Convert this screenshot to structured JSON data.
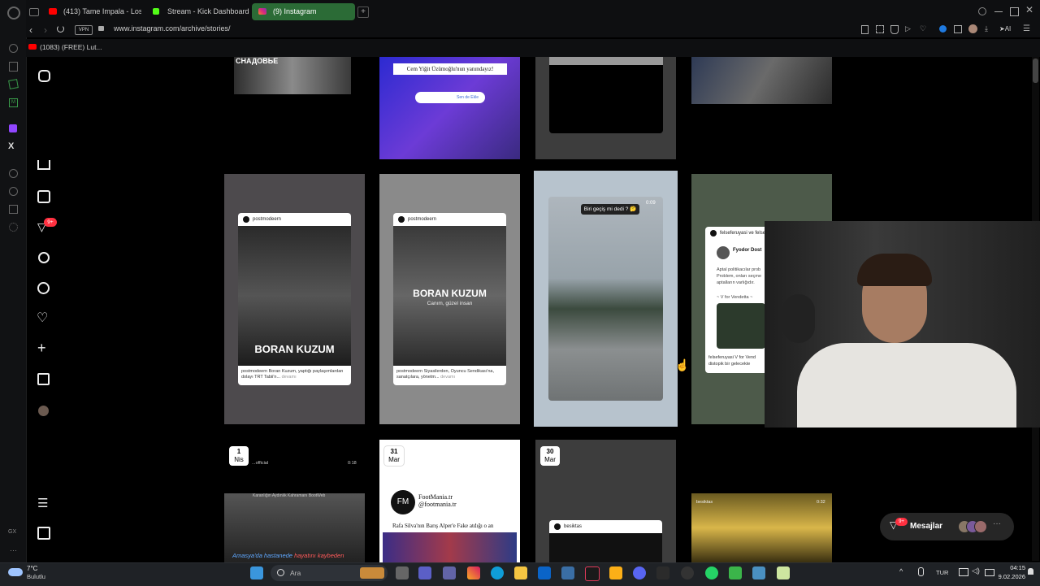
{
  "browser": {
    "tabs": [
      {
        "label": "(413) Tame Impala - Loser",
        "icon": "youtube-icon"
      },
      {
        "label": "Stream - Kick Dashboard",
        "icon": "kick-icon"
      },
      {
        "label": "(9) Instagram",
        "icon": "instagram-icon",
        "active": true
      }
    ],
    "url": "www.instagram.com/archive/stories/",
    "vpn_label": "VPN",
    "ai_label": "AI",
    "bookmarks": [
      {
        "label": "(1083) (FREE) Lut..."
      }
    ]
  },
  "instagram": {
    "nav": {
      "notification_badge": "9+",
      "items": [
        "instagram-logo-icon",
        "home-icon",
        "reels-icon",
        "send-icon",
        "search-icon",
        "explore-icon",
        "heart-icon",
        "create-icon",
        "dashboard-icon",
        "profile-avatar-icon",
        "menu-icon",
        "threads-icon"
      ]
    },
    "row1": {
      "tile1_text": "СНАДОВЬЕ",
      "tile2_banner": "Cem Yiğit Üzümoğlu'nun yanındayız!",
      "tile2_sticker": "Sen de Ekle"
    },
    "row2": {
      "tile1": {
        "account": "postmodeern",
        "headline": "BORAN KUZUM",
        "caption": "postmodeern Boran Kuzum, yaptığı paylaşımlardan dolayı TRT Tabii'n...",
        "more": "devamı"
      },
      "tile2": {
        "account": "postmodeern",
        "headline": "BORAN KUZUM",
        "subline": "Canım, güzel insan",
        "caption": "postmodeern Siyasilerden, Oyuncu Sendikası'na, sanatçılara, yönetm...",
        "more": "devamı"
      },
      "tile3": {
        "question": "Biri geçiş mi dedi ? 🤔",
        "time": "0:09"
      },
      "tile4": {
        "account": "felseferuyasi ve felsef",
        "author": "Fyodor Dost",
        "line1": "Aptal politikacılar prob",
        "line2": "Problem, onları seçme",
        "line3": "aptalların varlığıdır.",
        "quote": "~ V for Vendetta ~",
        "caption": "felseferuyasi V for Vend",
        "caption2": "distopik bir gelecekte"
      }
    },
    "row3": {
      "tile1": {
        "day": "1",
        "month": "Nis",
        "account": "...official",
        "time": "0:18",
        "subtitle_a": "Amasya'da hastanede ",
        "subtitle_b": "hayatını kaybeden",
        "watermark": "Karanlığın Aydınlık Kahramanı BootWeb"
      },
      "tile2": {
        "day": "31",
        "month": "Mar",
        "brand": "FootMania.tr",
        "handle": "@footmania.tr",
        "headline": "Rafa Silva'nın Barış Alper'e Fake atdığı o an"
      },
      "tile3": {
        "day": "30",
        "month": "Mar",
        "account": "besiktas"
      },
      "tile4": {
        "account": "besiktas",
        "time": "0:32"
      }
    },
    "messages": {
      "label": "Mesajlar",
      "badge": "9+"
    }
  },
  "taskbar": {
    "weather_temp": "7°C",
    "weather_desc": "Bulutlu",
    "search_placeholder": "Ara",
    "lang": "TUR",
    "time": "04:15",
    "date": "9.02.2026"
  },
  "colors": {
    "accent": "#4cd15a",
    "badge": "#ff3040",
    "active_tab": "#2b6b36"
  }
}
